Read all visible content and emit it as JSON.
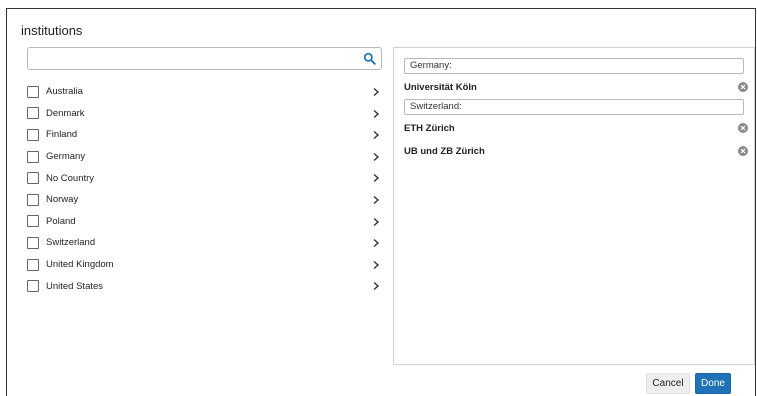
{
  "dialog": {
    "title": "institutions"
  },
  "search": {
    "value": "",
    "placeholder": ""
  },
  "countries": [
    {
      "label": "Australia"
    },
    {
      "label": "Denmark"
    },
    {
      "label": "Finland"
    },
    {
      "label": "Germany"
    },
    {
      "label": "No Country"
    },
    {
      "label": "Norway"
    },
    {
      "label": "Poland"
    },
    {
      "label": "Switzerland"
    },
    {
      "label": "United Kingdom"
    },
    {
      "label": "United States"
    }
  ],
  "selected": {
    "groups": [
      {
        "header": "Germany:",
        "institutions": [
          "Universität Köln"
        ]
      },
      {
        "header": "Switzerland:",
        "institutions": [
          "ETH Zürich",
          "UB und ZB Zürich"
        ]
      }
    ]
  },
  "buttons": {
    "cancel": "Cancel",
    "done": "Done"
  },
  "colors": {
    "primary": "#1e72b8",
    "cancel_bg": "#eeeeee",
    "border": "#b9b9b9"
  },
  "icons": {
    "search": "search-icon",
    "chevron": "chevron-right-icon",
    "remove": "remove-circle-icon"
  }
}
